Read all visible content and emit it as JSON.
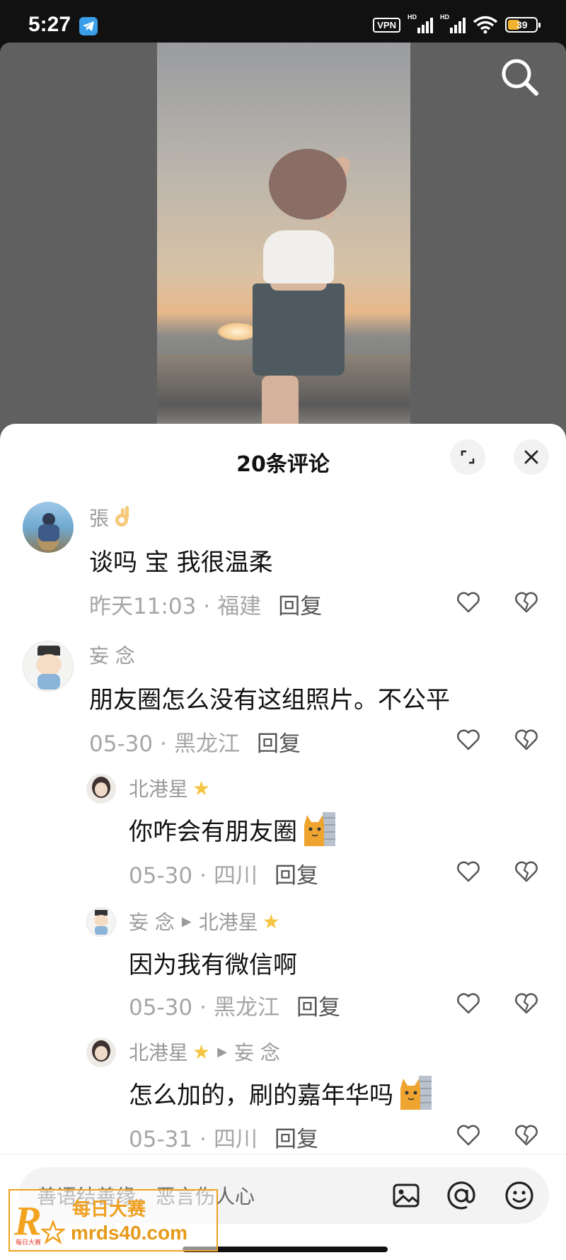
{
  "status_bar": {
    "time": "5:27",
    "vpn": "VPN",
    "hd1": "HD",
    "hd2": "HD",
    "battery": "39"
  },
  "sheet": {
    "title": "20条评论"
  },
  "comments": [
    {
      "name": "張",
      "text": "谈吗 宝 我很温柔",
      "date": "昨天11:03",
      "location": "福建",
      "reply": "回复"
    },
    {
      "name": "妄 念",
      "text": "朋友圈怎么没有这组照片。不公平",
      "date": "05-30",
      "location": "黑龙江",
      "reply": "回复"
    },
    {
      "name": "北港星",
      "text": "你咋会有朋友圈",
      "date": "05-30",
      "location": "四川",
      "reply": "回复"
    },
    {
      "name": "妄 念",
      "reply_to": "北港星",
      "text": "因为我有微信啊",
      "date": "05-30",
      "location": "黑龙江",
      "reply": "回复"
    },
    {
      "name": "北港星",
      "reply_to": "妄 念",
      "text": "怎么加的，刷的嘉年华吗",
      "date": "05-31",
      "location": "四川",
      "reply": "回复"
    }
  ],
  "input": {
    "placeholder": "善语结善缘，恶言伤人心"
  },
  "watermark": {
    "logo": "R",
    "line1": "每日大赛",
    "line2": "mrds40.com",
    "small": "每日大赛"
  },
  "colors": {
    "star": "#f5c642",
    "telegram": "#3a9ee8",
    "battery": "#f2b230",
    "watermark": "#f0a020"
  },
  "icons": [
    "telegram-icon",
    "wifi-icon",
    "signal-icon",
    "battery-icon",
    "search-icon",
    "expand-icon",
    "close-icon",
    "heart-icon",
    "broken-heart-icon",
    "image-icon",
    "at-icon",
    "emoji-icon"
  ]
}
